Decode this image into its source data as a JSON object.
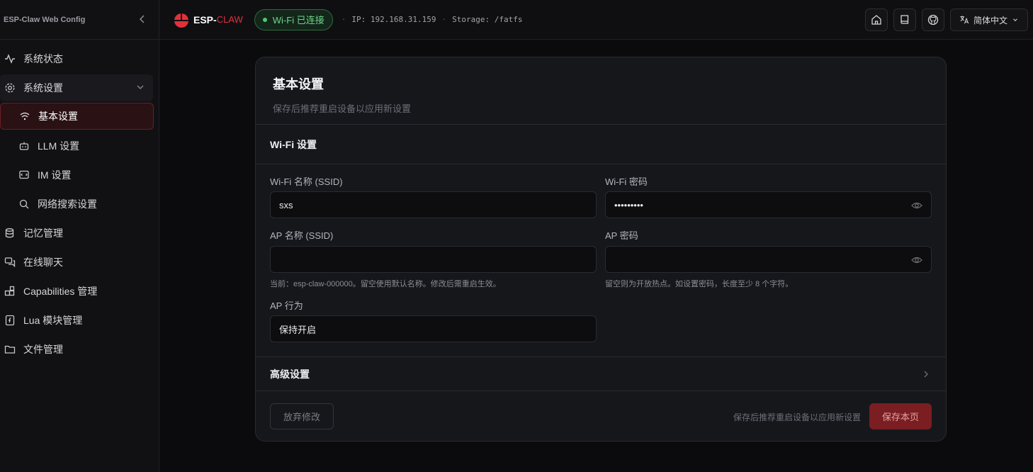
{
  "sidebar": {
    "title": "ESP-Claw Web Config",
    "items": [
      {
        "label": "系统状态",
        "icon": "activity-icon"
      },
      {
        "label": "系统设置",
        "icon": "gear-icon"
      },
      {
        "label": "基本设置",
        "icon": "wifi-icon"
      },
      {
        "label": "LLM 设置",
        "icon": "bot-icon"
      },
      {
        "label": "IM 设置",
        "icon": "message-icon"
      },
      {
        "label": "网络搜索设置",
        "icon": "search-icon"
      },
      {
        "label": "记忆管理",
        "icon": "database-icon"
      },
      {
        "label": "在线聊天",
        "icon": "chat-icon"
      },
      {
        "label": "Capabilities 管理",
        "icon": "blocks-icon"
      },
      {
        "label": "Lua 模块管理",
        "icon": "file-code-icon"
      },
      {
        "label": "文件管理",
        "icon": "folder-icon"
      }
    ]
  },
  "topbar": {
    "logo_esp": "ESP-",
    "logo_claw": "CLAW",
    "wifi_status": "Wi-Fi 已连接",
    "ip": "IP: 192.168.31.159",
    "storage": "Storage: /fatfs",
    "language": "简体中文"
  },
  "card": {
    "title": "基本设置",
    "subtitle": "保存后推荐重启设备以应用新设置",
    "wifi_section": "Wi-Fi 设置",
    "wifi_ssid_label": "Wi-Fi 名称 (SSID)",
    "wifi_ssid_value": "sxs",
    "wifi_password_label": "Wi-Fi 密码",
    "wifi_password_value": "•••••••••",
    "ap_ssid_label": "AP 名称 (SSID)",
    "ap_ssid_value": "",
    "ap_ssid_hint": "当前：esp-claw-000000。留空使用默认名称。修改后需重启生效。",
    "ap_password_label": "AP 密码",
    "ap_password_value": "",
    "ap_password_hint": "留空则为开放热点。如设置密码，长度至少 8 个字符。",
    "ap_behavior_label": "AP 行为",
    "ap_behavior_value": "保持开启",
    "advanced": "高级设置",
    "discard": "放弃修改",
    "footer_hint": "保存后推荐重启设备以应用新设置",
    "save": "保存本页"
  },
  "colors": {
    "accent": "#e0323a",
    "success": "#4ecb6b",
    "save_button": "#7a1e22"
  }
}
